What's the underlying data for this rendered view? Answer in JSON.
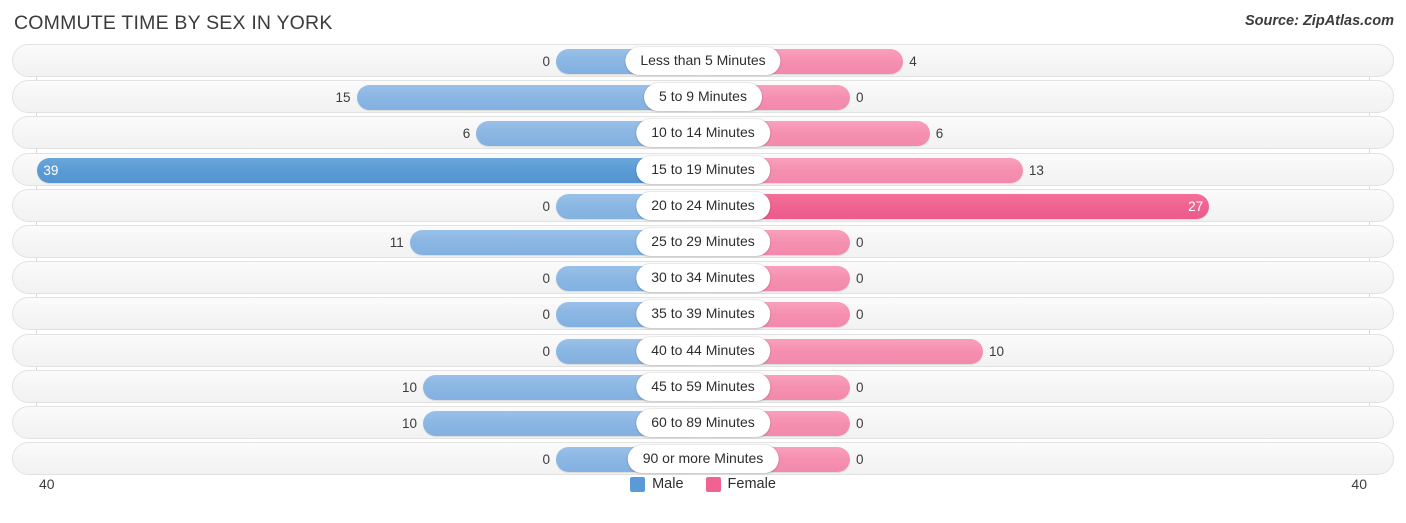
{
  "header": {
    "title": "COMMUTE TIME BY SEX IN YORK",
    "source": "Source: ZipAtlas.com"
  },
  "axis": {
    "left_label": "40",
    "right_label": "40",
    "max": 40
  },
  "legend": {
    "items": [
      {
        "label": "Male",
        "color": "#5b9bd5"
      },
      {
        "label": "Female",
        "color": "#ef6291"
      }
    ]
  },
  "colors": {
    "male_light": "#8ab6e3",
    "male_full": "#5b9bd5",
    "female_light": "#f58fb0",
    "female_full": "#ef6291",
    "track": "#f5f5f5",
    "track_border": "#e2e2e2"
  },
  "chart_data": {
    "type": "bar",
    "title": "COMMUTE TIME BY SEX IN YORK",
    "subtitle": "Source: ZipAtlas.com",
    "orientation": "horizontal-diverging",
    "xlabel": "",
    "ylabel": "",
    "xlim": [
      40,
      40
    ],
    "grid": false,
    "legend_position": "bottom-center",
    "categories": [
      "Less than 5 Minutes",
      "5 to 9 Minutes",
      "10 to 14 Minutes",
      "15 to 19 Minutes",
      "20 to 24 Minutes",
      "25 to 29 Minutes",
      "30 to 34 Minutes",
      "35 to 39 Minutes",
      "40 to 44 Minutes",
      "45 to 59 Minutes",
      "60 to 89 Minutes",
      "90 or more Minutes"
    ],
    "series": [
      {
        "name": "Male",
        "values": [
          0,
          15,
          6,
          39,
          0,
          11,
          0,
          0,
          0,
          10,
          10,
          0
        ]
      },
      {
        "name": "Female",
        "values": [
          4,
          0,
          6,
          13,
          27,
          0,
          0,
          0,
          10,
          0,
          0,
          0
        ]
      }
    ]
  },
  "rows": [
    {
      "category": "Less than 5 Minutes",
      "male": "0",
      "female": "4"
    },
    {
      "category": "5 to 9 Minutes",
      "male": "15",
      "female": "0"
    },
    {
      "category": "10 to 14 Minutes",
      "male": "6",
      "female": "6"
    },
    {
      "category": "15 to 19 Minutes",
      "male": "39",
      "female": "13"
    },
    {
      "category": "20 to 24 Minutes",
      "male": "0",
      "female": "27"
    },
    {
      "category": "25 to 29 Minutes",
      "male": "11",
      "female": "0"
    },
    {
      "category": "30 to 34 Minutes",
      "male": "0",
      "female": "0"
    },
    {
      "category": "35 to 39 Minutes",
      "male": "0",
      "female": "0"
    },
    {
      "category": "40 to 44 Minutes",
      "male": "0",
      "female": "10"
    },
    {
      "category": "45 to 59 Minutes",
      "male": "10",
      "female": "0"
    },
    {
      "category": "60 to 89 Minutes",
      "male": "10",
      "female": "0"
    },
    {
      "category": "90 or more Minutes",
      "male": "0",
      "female": "0"
    }
  ]
}
